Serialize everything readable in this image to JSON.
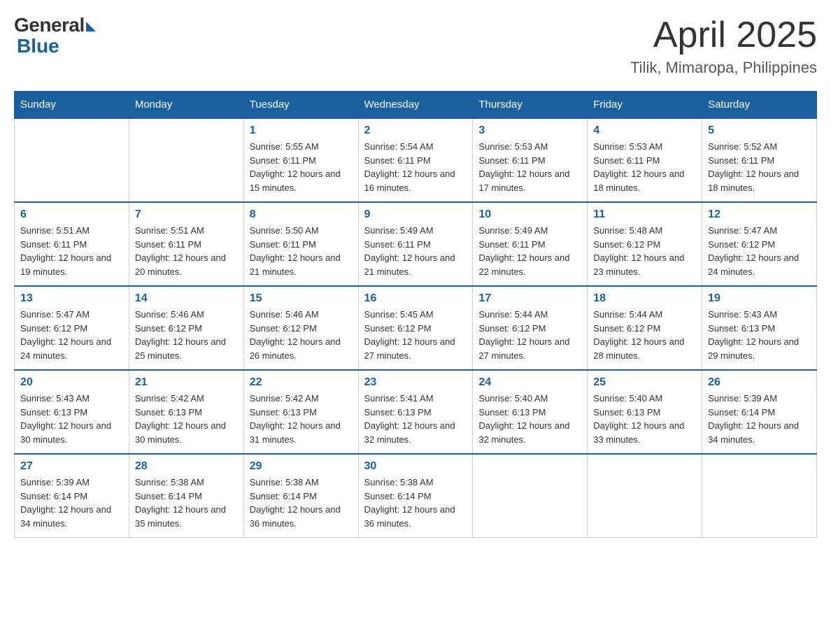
{
  "logo": {
    "general": "General",
    "blue": "Blue"
  },
  "title": {
    "month_year": "April 2025",
    "location": "Tilik, Mimaropa, Philippines"
  },
  "days_of_week": [
    "Sunday",
    "Monday",
    "Tuesday",
    "Wednesday",
    "Thursday",
    "Friday",
    "Saturday"
  ],
  "weeks": [
    [
      {
        "day": "",
        "info": ""
      },
      {
        "day": "",
        "info": ""
      },
      {
        "day": "1",
        "info": "Sunrise: 5:55 AM\nSunset: 6:11 PM\nDaylight: 12 hours and 15 minutes."
      },
      {
        "day": "2",
        "info": "Sunrise: 5:54 AM\nSunset: 6:11 PM\nDaylight: 12 hours and 16 minutes."
      },
      {
        "day": "3",
        "info": "Sunrise: 5:53 AM\nSunset: 6:11 PM\nDaylight: 12 hours and 17 minutes."
      },
      {
        "day": "4",
        "info": "Sunrise: 5:53 AM\nSunset: 6:11 PM\nDaylight: 12 hours and 18 minutes."
      },
      {
        "day": "5",
        "info": "Sunrise: 5:52 AM\nSunset: 6:11 PM\nDaylight: 12 hours and 18 minutes."
      }
    ],
    [
      {
        "day": "6",
        "info": "Sunrise: 5:51 AM\nSunset: 6:11 PM\nDaylight: 12 hours and 19 minutes."
      },
      {
        "day": "7",
        "info": "Sunrise: 5:51 AM\nSunset: 6:11 PM\nDaylight: 12 hours and 20 minutes."
      },
      {
        "day": "8",
        "info": "Sunrise: 5:50 AM\nSunset: 6:11 PM\nDaylight: 12 hours and 21 minutes."
      },
      {
        "day": "9",
        "info": "Sunrise: 5:49 AM\nSunset: 6:11 PM\nDaylight: 12 hours and 21 minutes."
      },
      {
        "day": "10",
        "info": "Sunrise: 5:49 AM\nSunset: 6:11 PM\nDaylight: 12 hours and 22 minutes."
      },
      {
        "day": "11",
        "info": "Sunrise: 5:48 AM\nSunset: 6:12 PM\nDaylight: 12 hours and 23 minutes."
      },
      {
        "day": "12",
        "info": "Sunrise: 5:47 AM\nSunset: 6:12 PM\nDaylight: 12 hours and 24 minutes."
      }
    ],
    [
      {
        "day": "13",
        "info": "Sunrise: 5:47 AM\nSunset: 6:12 PM\nDaylight: 12 hours and 24 minutes."
      },
      {
        "day": "14",
        "info": "Sunrise: 5:46 AM\nSunset: 6:12 PM\nDaylight: 12 hours and 25 minutes."
      },
      {
        "day": "15",
        "info": "Sunrise: 5:46 AM\nSunset: 6:12 PM\nDaylight: 12 hours and 26 minutes."
      },
      {
        "day": "16",
        "info": "Sunrise: 5:45 AM\nSunset: 6:12 PM\nDaylight: 12 hours and 27 minutes."
      },
      {
        "day": "17",
        "info": "Sunrise: 5:44 AM\nSunset: 6:12 PM\nDaylight: 12 hours and 27 minutes."
      },
      {
        "day": "18",
        "info": "Sunrise: 5:44 AM\nSunset: 6:12 PM\nDaylight: 12 hours and 28 minutes."
      },
      {
        "day": "19",
        "info": "Sunrise: 5:43 AM\nSunset: 6:13 PM\nDaylight: 12 hours and 29 minutes."
      }
    ],
    [
      {
        "day": "20",
        "info": "Sunrise: 5:43 AM\nSunset: 6:13 PM\nDaylight: 12 hours and 30 minutes."
      },
      {
        "day": "21",
        "info": "Sunrise: 5:42 AM\nSunset: 6:13 PM\nDaylight: 12 hours and 30 minutes."
      },
      {
        "day": "22",
        "info": "Sunrise: 5:42 AM\nSunset: 6:13 PM\nDaylight: 12 hours and 31 minutes."
      },
      {
        "day": "23",
        "info": "Sunrise: 5:41 AM\nSunset: 6:13 PM\nDaylight: 12 hours and 32 minutes."
      },
      {
        "day": "24",
        "info": "Sunrise: 5:40 AM\nSunset: 6:13 PM\nDaylight: 12 hours and 32 minutes."
      },
      {
        "day": "25",
        "info": "Sunrise: 5:40 AM\nSunset: 6:13 PM\nDaylight: 12 hours and 33 minutes."
      },
      {
        "day": "26",
        "info": "Sunrise: 5:39 AM\nSunset: 6:14 PM\nDaylight: 12 hours and 34 minutes."
      }
    ],
    [
      {
        "day": "27",
        "info": "Sunrise: 5:39 AM\nSunset: 6:14 PM\nDaylight: 12 hours and 34 minutes."
      },
      {
        "day": "28",
        "info": "Sunrise: 5:38 AM\nSunset: 6:14 PM\nDaylight: 12 hours and 35 minutes."
      },
      {
        "day": "29",
        "info": "Sunrise: 5:38 AM\nSunset: 6:14 PM\nDaylight: 12 hours and 36 minutes."
      },
      {
        "day": "30",
        "info": "Sunrise: 5:38 AM\nSunset: 6:14 PM\nDaylight: 12 hours and 36 minutes."
      },
      {
        "day": "",
        "info": ""
      },
      {
        "day": "",
        "info": ""
      },
      {
        "day": "",
        "info": ""
      }
    ]
  ]
}
